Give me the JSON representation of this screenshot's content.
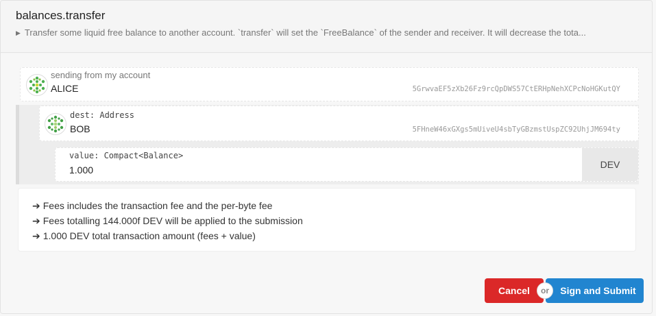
{
  "header": {
    "title": "balances.transfer",
    "description": "Transfer some liquid free balance to another account. `transfer` will set the `FreeBalance` of the sender and receiver. It will decrease the tota..."
  },
  "sender": {
    "label": "sending from my account",
    "name": "ALICE",
    "address": "5GrwvaEF5zXb26Fz9rcQpDWS57CtERHpNehXCPcNoHGKutQY"
  },
  "dest": {
    "label": "dest: Address",
    "name": "BOB",
    "address": "5FHneW46xGXgs5mUiveU4sbTyGBzmstUspZC92UhjJM694ty"
  },
  "value": {
    "label": "value: Compact<Balance>",
    "amount": "1.000",
    "unit": "DEV"
  },
  "fees": {
    "lines": [
      "Fees includes the transaction fee and the per-byte fee",
      "Fees totalling 144.000f DEV will be applied to the submission",
      "1.000 DEV total transaction amount (fees + value)"
    ],
    "arrow": "➔"
  },
  "actions": {
    "cancel_label": "Cancel",
    "or_label": "or",
    "submit_label": "Sign and Submit"
  },
  "colors": {
    "cancel": "#db2828",
    "submit": "#2185d0",
    "identicon": "#4caf50"
  }
}
